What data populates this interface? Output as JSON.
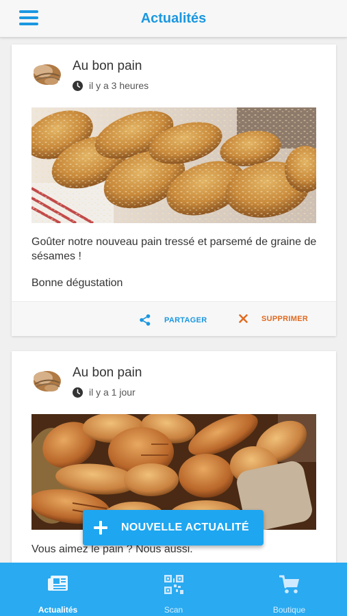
{
  "header": {
    "title": "Actualités"
  },
  "posts": [
    {
      "author": "Au bon pain",
      "time": "il y a 3 heures",
      "text": [
        "Goûter notre nouveau pain tressé et parsemé de graine de sésames !",
        "Bonne dégustation"
      ],
      "actions": {
        "share": "PARTAGER",
        "delete": "SUPPRIMER"
      }
    },
    {
      "author": "Au bon pain",
      "time": "il y a 1 jour",
      "text": [
        "Vous aimez le pain ?  Nous aussi."
      ]
    }
  ],
  "fab": {
    "label": "NOUVELLE ACTUALITÉ"
  },
  "tabs": [
    {
      "label": "Actualités",
      "icon": "newspaper-icon",
      "active": true
    },
    {
      "label": "Scan",
      "icon": "qr-code-icon",
      "active": false
    },
    {
      "label": "Boutique",
      "icon": "cart-icon",
      "active": false
    }
  ],
  "colors": {
    "accent": "#1a97e0",
    "tabbar": "#2aaaf0",
    "delete": "#e06a20"
  }
}
